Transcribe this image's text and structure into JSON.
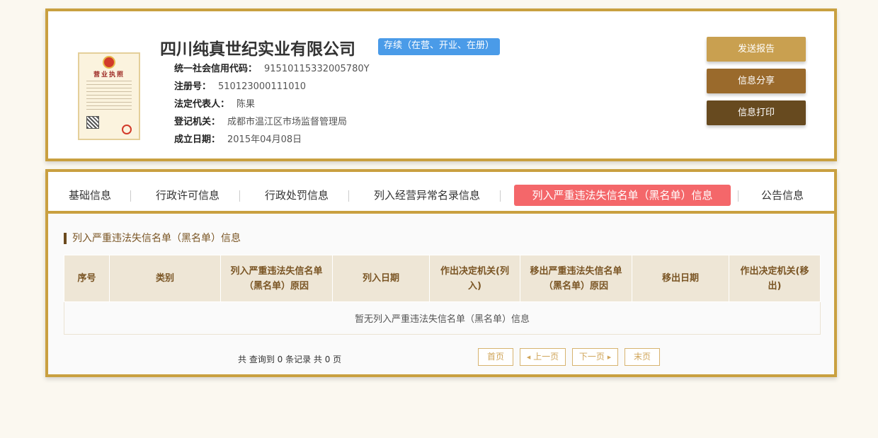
{
  "header": {
    "license_image": {
      "title": "营业执照"
    },
    "company_name": "四川纯真世纪实业有限公司",
    "status": "存续（在营、开业、在册）",
    "fields": [
      {
        "label": "统一社会信用代码：",
        "value": "91510115332005780Y"
      },
      {
        "label": "注册号：",
        "value": "510123000111010"
      },
      {
        "label": "法定代表人：",
        "value": "陈果"
      },
      {
        "label": "登记机关：",
        "value": "成都市温江区市场监督管理局"
      },
      {
        "label": "成立日期：",
        "value": "2015年04月08日"
      }
    ],
    "actions": [
      {
        "label": "发送报告",
        "color": "#c9a050"
      },
      {
        "label": "信息分享",
        "color": "#9a6a2c"
      },
      {
        "label": "信息打印",
        "color": "#674a1f"
      }
    ]
  },
  "tabs": [
    {
      "label": "基础信息",
      "active": false
    },
    {
      "label": "行政许可信息",
      "active": false
    },
    {
      "label": "行政处罚信息",
      "active": false
    },
    {
      "label": "列入经营异常名录信息",
      "active": false
    },
    {
      "label": "列入严重违法失信名单（黑名单）信息",
      "active": true
    },
    {
      "label": "公告信息",
      "active": false
    }
  ],
  "section": {
    "title": "列入严重违法失信名单（黑名单）信息",
    "table": {
      "headers": [
        "序号",
        "类别",
        "列入严重违法失信名单（黑名单）原因",
        "列入日期",
        "作出决定机关(列入)",
        "移出严重违法失信名单（黑名单）原因",
        "移出日期",
        "作出决定机关(移出)"
      ],
      "empty_message": "暂无列入严重违法失信名单（黑名单）信息"
    }
  },
  "pagination": {
    "summary": "共 查询到 0 条记录 共 0 页",
    "first": "首页",
    "prev": "上一页",
    "next": "下一页",
    "last": "末页"
  },
  "colors": {
    "border_gold": "#c9a040",
    "status_blue": "#4a9be8",
    "active_tab": "#f4676a",
    "header_text_brown": "#7a5524"
  }
}
